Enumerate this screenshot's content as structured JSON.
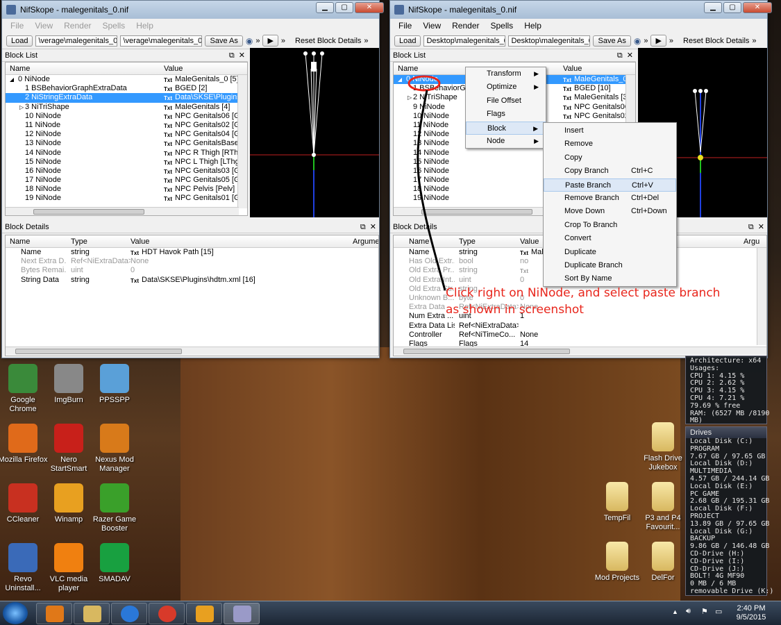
{
  "left_window": {
    "title": "NifSkope - malegenitals_0.nif",
    "menu": [
      "File",
      "View",
      "Render",
      "Spells",
      "Help"
    ],
    "toolbar": {
      "load": "Load",
      "field1": "\\verage\\malegenitals_0.nif",
      "field2": "\\verage\\malegenitals_0.nif",
      "save": "Save As",
      "reset": "Reset Block Details"
    },
    "block_list_title": "Block List",
    "col_name": "Name",
    "col_value": "Value",
    "rows": [
      {
        "name": "0 NiNode",
        "value": "MaleGenitals_0 [5]",
        "indent": 0,
        "exp": "◢"
      },
      {
        "name": "1 BSBehaviorGraphExtraData",
        "value": "BGED [2]",
        "indent": 1,
        "exp": ""
      },
      {
        "name": "2 NiStringExtraData",
        "value": "Data\\SKSE\\Plugins\\",
        "indent": 1,
        "exp": "",
        "sel": true
      },
      {
        "name": "3 NiTriShape",
        "value": "MaleGenitals [4]",
        "indent": 1,
        "exp": "▷"
      },
      {
        "name": "10 NiNode",
        "value": "NPC Genitals06 [Ge",
        "indent": 1,
        "exp": ""
      },
      {
        "name": "11 NiNode",
        "value": "NPC Genitals02 [Ge",
        "indent": 1,
        "exp": ""
      },
      {
        "name": "12 NiNode",
        "value": "NPC Genitals04 [Ge",
        "indent": 1,
        "exp": ""
      },
      {
        "name": "13 NiNode",
        "value": "NPC GenitalsBase [",
        "indent": 1,
        "exp": ""
      },
      {
        "name": "14 NiNode",
        "value": "NPC R Thigh [RThg",
        "indent": 1,
        "exp": ""
      },
      {
        "name": "15 NiNode",
        "value": "NPC L Thigh [LThg]",
        "indent": 1,
        "exp": ""
      },
      {
        "name": "16 NiNode",
        "value": "NPC Genitals03 [Ge",
        "indent": 1,
        "exp": ""
      },
      {
        "name": "17 NiNode",
        "value": "NPC Genitals05 [Ge",
        "indent": 1,
        "exp": ""
      },
      {
        "name": "18 NiNode",
        "value": "NPC Pelvis [Pelv] [1",
        "indent": 1,
        "exp": ""
      },
      {
        "name": "19 NiNode",
        "value": "NPC Genitals01 [Ge",
        "indent": 1,
        "exp": ""
      }
    ],
    "details_title": "Block Details",
    "dcols": {
      "name": "Name",
      "type": "Type",
      "value": "Value",
      "args": "Argume"
    },
    "details": [
      {
        "name": "Name",
        "type": "string",
        "value": "HDT Havok Path [15]",
        "txt": true,
        "dim": false
      },
      {
        "name": "Next Extra D...",
        "type": "Ref<NiExtraData>",
        "value": "None",
        "txt": false,
        "dim": true
      },
      {
        "name": "Bytes Remai...",
        "type": "uint",
        "value": "0",
        "txt": false,
        "dim": true
      },
      {
        "name": "String Data",
        "type": "string",
        "value": "Data\\SKSE\\Plugins\\hdtm.xml [16]",
        "txt": true,
        "dim": false
      }
    ]
  },
  "right_window": {
    "title": "NifSkope - malegenitals_0.nif",
    "menu": [
      "File",
      "View",
      "Render",
      "Spells",
      "Help"
    ],
    "toolbar": {
      "load": "Load",
      "field1": "Desktop\\malegenitals_0.nif",
      "field2": "Desktop\\malegenitals_0.nif",
      "save": "Save As",
      "reset": "Reset Block Details"
    },
    "block_list_title": "Block List",
    "col_name": "Name",
    "col_value": "Value",
    "rows": [
      {
        "name": "0 NiNode",
        "value": "MaleGenitals_0 [5]",
        "indent": 0,
        "exp": "◢",
        "sel": true
      },
      {
        "name": "1 BSBehaviorG",
        "value": "BGED [10]",
        "indent": 1,
        "exp": ""
      },
      {
        "name": "2 NiTriShape",
        "value": "MaleGenitals [3]",
        "indent": 1,
        "exp": "▷"
      },
      {
        "name": "9 NiNode",
        "value": "NPC Genitals06 [Ge",
        "indent": 1,
        "exp": ""
      },
      {
        "name": "10 NiNode",
        "value": "NPC Genitals02 [Ge",
        "indent": 1,
        "exp": ""
      },
      {
        "name": "11 NiNode",
        "value": "",
        "indent": 1,
        "exp": ""
      },
      {
        "name": "12 NiNode",
        "value": "",
        "indent": 1,
        "exp": ""
      },
      {
        "name": "13 NiNode",
        "value": "",
        "indent": 1,
        "exp": ""
      },
      {
        "name": "14 NiNode",
        "value": "",
        "indent": 1,
        "exp": ""
      },
      {
        "name": "15 NiNode",
        "value": "",
        "indent": 1,
        "exp": ""
      },
      {
        "name": "16 NiNode",
        "value": "",
        "indent": 1,
        "exp": ""
      },
      {
        "name": "17 NiNode",
        "value": "",
        "indent": 1,
        "exp": ""
      },
      {
        "name": "18 NiNode",
        "value": "",
        "indent": 1,
        "exp": ""
      },
      {
        "name": "19 NiNode",
        "value": "",
        "indent": 1,
        "exp": ""
      }
    ],
    "details_title": "Block Details",
    "dcols": {
      "name": "Name",
      "type": "Type",
      "value": "Value",
      "args": "Argu"
    },
    "details": [
      {
        "name": "Name",
        "type": "string",
        "value": "Male",
        "txt": true,
        "dim": false
      },
      {
        "name": "Has Old Extr...",
        "type": "bool",
        "value": "no",
        "txt": false,
        "dim": true
      },
      {
        "name": "Old Extra Pr...",
        "type": "string",
        "value": "",
        "txt": true,
        "dim": true
      },
      {
        "name": "Old Extra Int...",
        "type": "uint",
        "value": "0",
        "txt": false,
        "dim": true
      },
      {
        "name": "Old Extra Str...",
        "type": "string",
        "value": "",
        "txt": false,
        "dim": true
      },
      {
        "name": "Unknown B...",
        "type": "byte",
        "value": "0",
        "txt": false,
        "dim": true
      },
      {
        "name": "Extra Data",
        "type": "Ref<NiExtraData>",
        "value": "None",
        "txt": false,
        "dim": true
      },
      {
        "name": "Num Extra ...",
        "type": "uint",
        "value": "1",
        "txt": false,
        "dim": false
      },
      {
        "name": "Extra Data List",
        "type": "Ref<NiExtraData>",
        "value": "",
        "txt": false,
        "dim": false
      },
      {
        "name": "Controller",
        "type": "Ref<NiTimeCo...",
        "value": "None",
        "txt": false,
        "dim": false
      },
      {
        "name": "Flags",
        "type": "Flags",
        "value": "14",
        "txt": false,
        "dim": false
      }
    ]
  },
  "context_menu": [
    {
      "label": "Transform",
      "submenu": true
    },
    {
      "label": "Optimize",
      "submenu": true
    },
    {
      "label": "File Offset",
      "submenu": false
    },
    {
      "label": "Flags",
      "submenu": false
    },
    {
      "label": "Block",
      "submenu": true,
      "hl": true
    },
    {
      "label": "Node",
      "submenu": true
    }
  ],
  "block_submenu": [
    {
      "label": "Insert",
      "shortcut": ""
    },
    {
      "label": "Remove",
      "shortcut": ""
    },
    {
      "label": "Copy",
      "shortcut": ""
    },
    {
      "label": "Copy Branch",
      "shortcut": "Ctrl+C"
    },
    {
      "label": "Paste Branch",
      "shortcut": "Ctrl+V",
      "hl": true
    },
    {
      "label": "Remove Branch",
      "shortcut": "Ctrl+Del"
    },
    {
      "label": "Move Down",
      "shortcut": "Ctrl+Down"
    },
    {
      "label": "Crop To Branch",
      "shortcut": ""
    },
    {
      "label": "Convert",
      "shortcut": ""
    },
    {
      "label": "Duplicate",
      "shortcut": ""
    },
    {
      "label": "Duplicate Branch",
      "shortcut": ""
    },
    {
      "label": "Sort By Name",
      "shortcut": ""
    }
  ],
  "annotation": {
    "line1": "Click right on NiNode, and select paste branch",
    "line2": "as shown in screenshot"
  },
  "desktop_icons": [
    {
      "label": "Google Chrome",
      "color": "#3a8a3a"
    },
    {
      "label": "ImgBurn",
      "color": "#888"
    },
    {
      "label": "PPSSPP",
      "color": "#5aa0d8"
    },
    {
      "label": "Mozilla Firefox",
      "color": "#e06a1a"
    },
    {
      "label": "Nero StartSmart",
      "color": "#c8201a"
    },
    {
      "label": "Nexus Mod Manager",
      "color": "#d87a1a"
    },
    {
      "label": "CCleaner",
      "color": "#c83020"
    },
    {
      "label": "Winamp",
      "color": "#e8a020"
    },
    {
      "label": "Razer Game Booster",
      "color": "#3aa02a"
    },
    {
      "label": "Revo Uninstall...",
      "color": "#3a6ab8"
    },
    {
      "label": "VLC media player",
      "color": "#f08010"
    },
    {
      "label": "SMADAV",
      "color": "#18a040"
    }
  ],
  "right_icons": [
    {
      "label": "Flash Drive Jukebox"
    },
    {
      "label": "TempFil"
    },
    {
      "label": "P3 and P4 Favourit..."
    },
    {
      "label": "Mod Projects"
    },
    {
      "label": "DelFor"
    }
  ],
  "sysgadget": {
    "lines": [
      "Architecture: x64",
      "Usages:",
      "CPU 1: 4.15 %",
      "CPU 2: 2.62 %",
      "CPU 3: 4.15 %",
      "CPU 4: 7.21 %",
      "79.69 % free",
      "RAM: (6527 MB /8190",
      "MB)"
    ]
  },
  "drives": {
    "title": "Drives",
    "lines": [
      "Local Disk (C:)",
      "PROGRAM",
      "7.67 GB / 97.65 GB",
      "Local Disk (D:)",
      "MULTIMEDIA",
      "4.57 GB / 244.14 GB",
      "Local Disk (E:)",
      "PC GAME",
      "2.68 GB / 195.31 GB",
      "Local Disk (F:)",
      "PROJECT",
      "13.89 GB / 97.65 GB",
      "Local Disk (G:)",
      "BACKUP",
      "9.86 GB / 146.48 GB",
      "CD-Drive (H:)",
      "CD-Drive (I:)",
      "CD-Drive (J:)",
      "BOLT! 4G MF90",
      "0 MB / 6 MB",
      "removable Drive (K:)"
    ]
  },
  "taskbar": {
    "time": "2:40 PM",
    "date": "9/5/2015"
  }
}
